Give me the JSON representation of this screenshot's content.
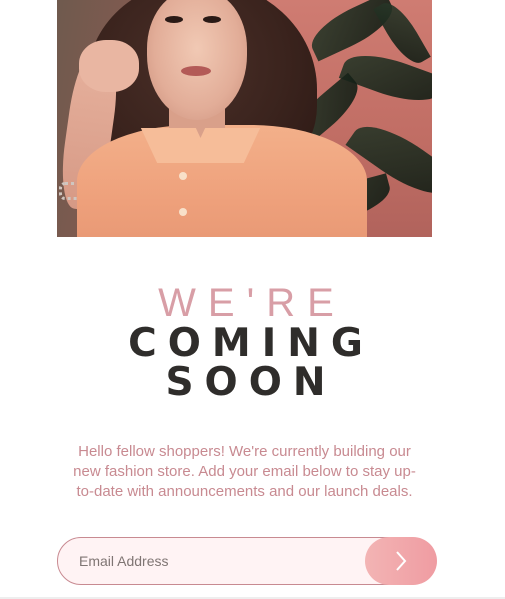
{
  "hero": {
    "image_alt": "Woman in peach shirt"
  },
  "headline": {
    "line1": "WE'RE",
    "line2": "COMING",
    "line3": "SOON"
  },
  "intro": {
    "text": "Hello fellow shoppers! We're currently building our new fashion store. Add your email below to stay up-to-date with announcements and our launch deals."
  },
  "email_form": {
    "placeholder": "Email Address",
    "value": "",
    "submit_icon": "chevron-right-icon"
  },
  "colors": {
    "accent_pink": "#d89ea6",
    "text_pink": "#c88a91",
    "heading_dark": "#2f2d2b",
    "button_gradient_start": "#f3b4b4",
    "button_gradient_end": "#ef9ca2"
  }
}
